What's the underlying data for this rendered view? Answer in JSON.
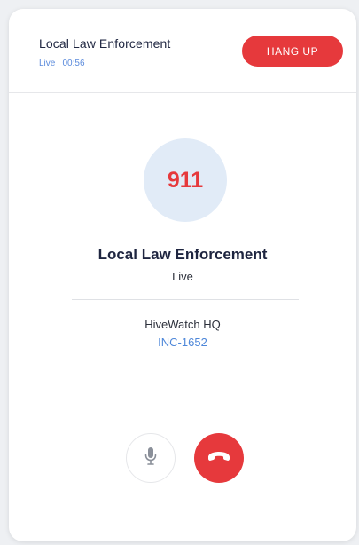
{
  "header": {
    "title": "Local Law Enforcement",
    "status": "Live | 00:56",
    "hangup_label": "HANG UP"
  },
  "caller": {
    "avatar_text": "911",
    "name": "Local Law Enforcement",
    "status": "Live",
    "location": "HiveWatch HQ",
    "incident_id": "INC-1652"
  },
  "controls": {
    "mic_icon": "microphone-icon",
    "end_call_icon": "phone-hangup-icon"
  },
  "colors": {
    "accent_red": "#e6393c",
    "accent_blue": "#4e87d9",
    "avatar_bg": "#e1ebf7",
    "text_dark": "#1e2540"
  }
}
